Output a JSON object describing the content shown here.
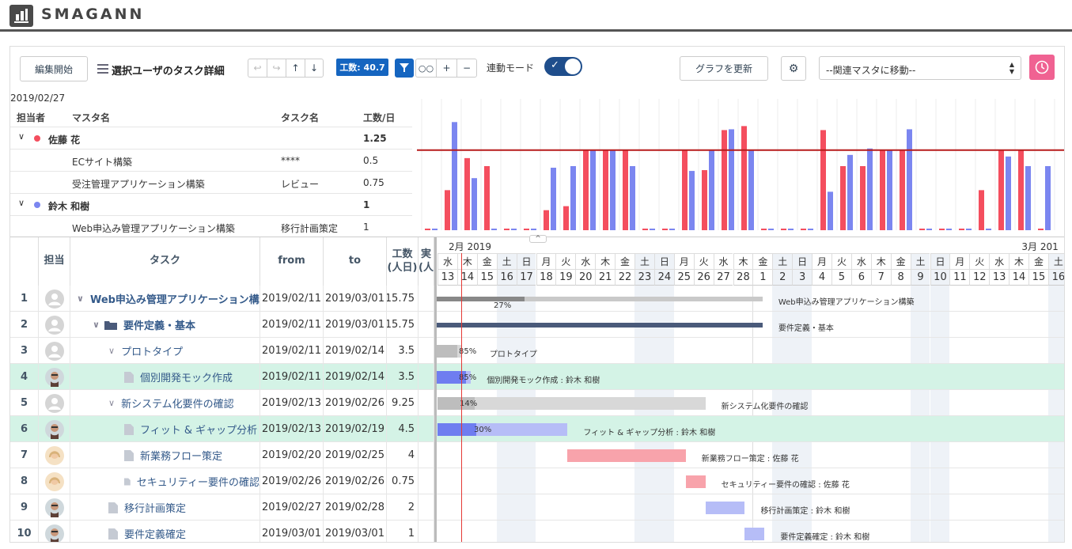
{
  "app": {
    "brand": "SMAGANN"
  },
  "toolbar": {
    "edit_label": "編集開始",
    "title": "選択ユーザのタスク詳細",
    "workload_badge": "工数: 40.7",
    "link_mode_label": "連動モード",
    "refresh_label": "グラフを更新",
    "master_select": "--関連マスタに移動--"
  },
  "summary": {
    "date": "2019/02/27",
    "headers": {
      "assignee": "担当者",
      "master": "マスタ名",
      "task": "タスク名",
      "workload": "工数/日"
    },
    "rows": [
      {
        "type": "group",
        "name": "佐藤 花",
        "color": "#f44e5e",
        "workload": "1.25"
      },
      {
        "type": "item",
        "master": "ECサイト構築",
        "task": "****",
        "workload": "0.5"
      },
      {
        "type": "item",
        "master": "受注管理アプリケーション構築",
        "task": "レビュー",
        "workload": "0.75"
      },
      {
        "type": "group",
        "name": "鈴木 和樹",
        "color": "#7b86f0",
        "workload": "1"
      },
      {
        "type": "item",
        "master": "Web申込み管理アプリケーション構築",
        "task": "移行計画策定",
        "workload": "1"
      }
    ]
  },
  "chart_data": {
    "type": "bar",
    "series": [
      {
        "color": "#f44e5e"
      },
      {
        "color": "#7b86f0"
      }
    ],
    "ylim": [
      0,
      1.6
    ],
    "reference_line": 1.0,
    "categories": [
      "2/13",
      "2/14",
      "2/15",
      "2/16",
      "2/17",
      "2/18",
      "2/19",
      "2/20",
      "2/21",
      "2/22",
      "2/23",
      "2/24",
      "2/25",
      "2/26",
      "2/27",
      "2/28",
      "3/1",
      "3/2",
      "3/3",
      "3/4",
      "3/5",
      "3/6",
      "3/7",
      "3/8",
      "3/9",
      "3/10",
      "3/11",
      "3/12",
      "3/13",
      "3/14",
      "3/15",
      "3/16"
    ],
    "values_a": [
      0.02,
      0.5,
      0.9,
      0.8,
      0.02,
      0.02,
      0.25,
      0.3,
      1.0,
      1.0,
      1.0,
      0.02,
      0.02,
      1.0,
      0.75,
      1.25,
      1.3,
      0.02,
      0.02,
      0.02,
      1.25,
      0.8,
      0.8,
      1.0,
      1.0,
      0.02,
      0.02,
      0.02,
      0.5,
      1.0,
      1.0,
      0.02
    ],
    "values_b": [
      0.02,
      1.35,
      0.65,
      0.02,
      0.02,
      0.02,
      0.78,
      0.8,
      1.0,
      1.0,
      0.8,
      0.02,
      0.02,
      0.74,
      1.0,
      1.26,
      1.0,
      0.02,
      0.02,
      0.02,
      0.48,
      0.94,
      1.02,
      1.0,
      1.26,
      0.02,
      0.02,
      0.02,
      0.02,
      0.92,
      0.8,
      0.8
    ]
  },
  "gantt": {
    "headers": {
      "assignee": "担当",
      "task": "タスク",
      "from": "from",
      "to": "to",
      "workload": "工数\n(人日)",
      "actual": "実\n(人"
    },
    "months": [
      {
        "label": "2月 2019"
      },
      {
        "label": "3月 201"
      }
    ],
    "days": [
      {
        "dow": "水",
        "d": "13"
      },
      {
        "dow": "木",
        "d": "14"
      },
      {
        "dow": "金",
        "d": "15"
      },
      {
        "dow": "土",
        "d": "16"
      },
      {
        "dow": "日",
        "d": "17"
      },
      {
        "dow": "月",
        "d": "18"
      },
      {
        "dow": "火",
        "d": "19"
      },
      {
        "dow": "水",
        "d": "20"
      },
      {
        "dow": "木",
        "d": "21"
      },
      {
        "dow": "金",
        "d": "22"
      },
      {
        "dow": "土",
        "d": "23"
      },
      {
        "dow": "日",
        "d": "24"
      },
      {
        "dow": "月",
        "d": "25"
      },
      {
        "dow": "火",
        "d": "26"
      },
      {
        "dow": "水",
        "d": "27"
      },
      {
        "dow": "木",
        "d": "28"
      },
      {
        "dow": "金",
        "d": "1"
      },
      {
        "dow": "土",
        "d": "2"
      },
      {
        "dow": "日",
        "d": "3"
      },
      {
        "dow": "月",
        "d": "4"
      },
      {
        "dow": "火",
        "d": "5"
      },
      {
        "dow": "水",
        "d": "6"
      },
      {
        "dow": "木",
        "d": "7"
      },
      {
        "dow": "金",
        "d": "8"
      },
      {
        "dow": "土",
        "d": "9"
      },
      {
        "dow": "日",
        "d": "10"
      },
      {
        "dow": "月",
        "d": "11"
      },
      {
        "dow": "火",
        "d": "12"
      },
      {
        "dow": "水",
        "d": "13"
      },
      {
        "dow": "木",
        "d": "14"
      },
      {
        "dow": "金",
        "d": "15"
      },
      {
        "dow": "土",
        "d": "16"
      }
    ],
    "rows": [
      {
        "no": "1",
        "avatar": "placeholder",
        "indent": 0,
        "icon": "chevron",
        "task": "Web申込み管理アプリケーション構築",
        "from": "2019/02/11",
        "to": "2019/03/01",
        "workload": "15.75",
        "bold": true,
        "highlight": false,
        "bar": {
          "start": -2,
          "end": 16.5,
          "progress": 0.27,
          "style": "summary"
        },
        "pct": "27%",
        "label": "Web申込み管理アプリケーション構築"
      },
      {
        "no": "2",
        "avatar": "placeholder",
        "indent": 1,
        "icon": "folder",
        "task": "要件定義・基本",
        "from": "2019/02/11",
        "to": "2019/03/01",
        "workload": "15.75",
        "bold": true,
        "highlight": false,
        "bar": {
          "start": -2,
          "end": 16.5,
          "progress": 1,
          "style": "phase"
        },
        "pct": "",
        "label": "要件定義・基本"
      },
      {
        "no": "3",
        "avatar": "placeholder",
        "indent": 2,
        "icon": "chevron",
        "task": "プロトタイプ",
        "from": "2019/02/11",
        "to": "2019/02/14",
        "workload": "3.5",
        "bold": false,
        "highlight": false,
        "bar": {
          "start": -2,
          "end": 1.2,
          "progress": 0.85,
          "style": "group"
        },
        "pct": "85%",
        "label": "プロトタイプ"
      },
      {
        "no": "4",
        "avatar": "man",
        "indent": 3,
        "icon": "file",
        "task": "個別開発モック作成",
        "from": "2019/02/11",
        "to": "2019/02/14",
        "workload": "3.5",
        "bold": false,
        "highlight": true,
        "bar": {
          "start": -2,
          "end": 1.7,
          "progress": 0.85,
          "style": "blue"
        },
        "pct": "85%",
        "label": "個別開発モック作成 : 鈴木 和樹"
      },
      {
        "no": "5",
        "avatar": "placeholder",
        "indent": 2,
        "icon": "chevron",
        "task": "新システム化要件の確認",
        "from": "2019/02/13",
        "to": "2019/02/26",
        "workload": "9.25",
        "bold": false,
        "highlight": false,
        "bar": {
          "start": 0,
          "end": 13.6,
          "progress": 0.14,
          "style": "group"
        },
        "pct": "14%",
        "label": "新システム化要件の確認"
      },
      {
        "no": "6",
        "avatar": "man",
        "indent": 3,
        "icon": "file",
        "task": "フィット & ギャップ分析",
        "from": "2019/02/13",
        "to": "2019/02/19",
        "workload": "4.5",
        "bold": false,
        "highlight": true,
        "bar": {
          "start": 0,
          "end": 6.6,
          "progress": 0.3,
          "style": "blue"
        },
        "pct": "30%",
        "label": "フィット & ギャップ分析 : 鈴木 和樹"
      },
      {
        "no": "7",
        "avatar": "woman",
        "indent": 3,
        "icon": "file",
        "task": "新業務フロー策定",
        "from": "2019/02/20",
        "to": "2019/02/25",
        "workload": "4",
        "bold": false,
        "highlight": false,
        "bar": {
          "start": 6.6,
          "end": 12.6,
          "progress": 0,
          "style": "red"
        },
        "pct": "",
        "label": "新業務フロー策定 : 佐藤 花"
      },
      {
        "no": "8",
        "avatar": "woman",
        "indent": 3,
        "icon": "file",
        "task": "セキュリティー要件の確認",
        "from": "2019/02/26",
        "to": "2019/02/26",
        "workload": "0.75",
        "bold": false,
        "highlight": false,
        "bar": {
          "start": 12.6,
          "end": 13.6,
          "progress": 0,
          "style": "red"
        },
        "pct": "",
        "label": "セキュリティー要件の確認 : 佐藤 花"
      },
      {
        "no": "9",
        "avatar": "man",
        "indent": 2,
        "icon": "file",
        "task": "移行計画策定",
        "from": "2019/02/27",
        "to": "2019/02/28",
        "workload": "2",
        "bold": false,
        "highlight": false,
        "bar": {
          "start": 13.6,
          "end": 15.6,
          "progress": 0,
          "style": "blue"
        },
        "pct": "",
        "label": "移行計画策定 : 鈴木 和樹"
      },
      {
        "no": "10",
        "avatar": "man",
        "indent": 2,
        "icon": "file",
        "task": "要件定義確定",
        "from": "2019/03/01",
        "to": "2019/03/01",
        "workload": "1",
        "bold": false,
        "highlight": false,
        "bar": {
          "start": 15.6,
          "end": 16.6,
          "progress": 0,
          "style": "blue"
        },
        "pct": "",
        "label": "要件定義確定 : 鈴木 和樹"
      }
    ]
  }
}
